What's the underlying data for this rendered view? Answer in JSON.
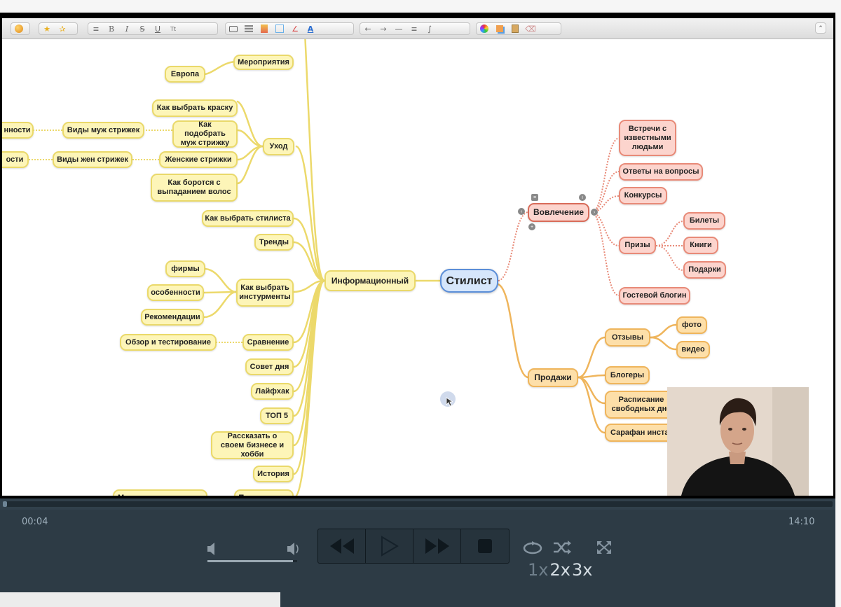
{
  "player": {
    "elapsed": "00:04",
    "duration": "14:10",
    "progress": 0.005,
    "volume": 0.95,
    "speeds": [
      "1x",
      "2x",
      "3x"
    ],
    "selected_speed": "1x"
  },
  "toolbar": {
    "groups": [
      [
        "palette-icon"
      ],
      [
        "star-icon",
        "star-plus-icon"
      ],
      [
        "align-center-icon",
        "bold-icon",
        "italic-icon",
        "strike-icon",
        "underline-icon",
        "text-size-icon"
      ],
      [
        "shape-rect-icon",
        "fill-gray-icon",
        "fill-gradient-icon",
        "border-icon",
        "line-color-icon",
        "text-color-icon"
      ],
      [
        "arrow-left-icon",
        "arrow-right-icon",
        "line-solid-icon",
        "line-thick-icon",
        "curve-icon"
      ],
      [
        "color-wheel-icon",
        "copy-style-icon",
        "paste-style-icon",
        "eraser-icon"
      ]
    ],
    "letters": {
      "bold": "B",
      "italic": "I",
      "underline": "U",
      "text_color": "A"
    }
  },
  "mindmap": {
    "center": "Стилист",
    "info": "Информационный",
    "left": {
      "europe": "Европа",
      "events": "Мероприятия",
      "choose_paint": "Как выбрать краску",
      "men_haircuts_sub": "нности",
      "men_haircuts": "Виды муж стрижек",
      "choose_men": "Как подобрать муж стрижку",
      "care": "Уход",
      "women_sub": "ости",
      "women_types": "Виды жен стрижек",
      "women_cuts": "Женские стрижки",
      "hair_loss": "Как боротся с выпаданием волос",
      "choose_stylist": "Как выбрать стилиста",
      "trends": "Тренды",
      "firms": "фирмы",
      "features": "особенности",
      "recommendations": "Рекомендации",
      "choose_tools": "Как выбрать инстурменты",
      "review": "Обзор и тестирование",
      "comparison": "Сравнение",
      "advice": "Совет дня",
      "lifehack": "Лайфхак",
      "top5": "ТОП 5",
      "business": "Рассказать о своем бизнесе и хобби",
      "history": "История",
      "masters": "Мастера этих городов",
      "travel": "Путешествия"
    },
    "engagement": {
      "label": "Вовлечение",
      "meetings": "Встречи с известными людьми",
      "answers": "Ответы на вопросы",
      "contests": "Конкурсы",
      "prizes": "Призы",
      "tickets": "Билеты",
      "books": "Книги",
      "gifts": "Подарки",
      "guest": "Гостевой блогин"
    },
    "sales": {
      "label": "Продажи",
      "reviews": "Отзывы",
      "photo": "фото",
      "video": "видео",
      "bloggers": "Блогеры",
      "schedule": "Расписание свободных дне",
      "word": "Сарафан инста"
    }
  }
}
